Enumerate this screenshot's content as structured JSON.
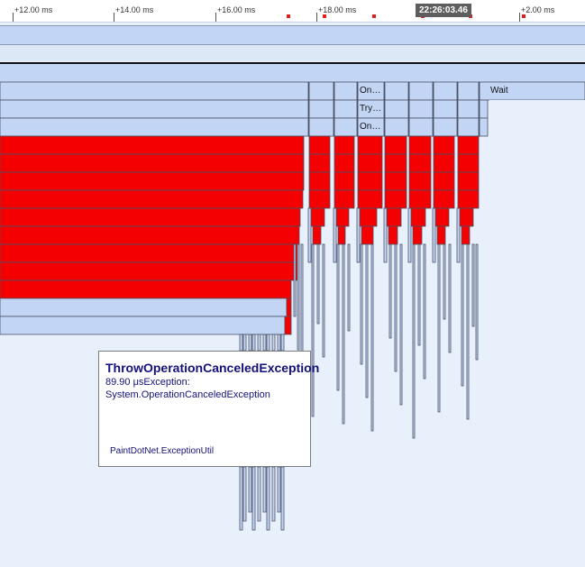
{
  "ruler": {
    "ticks": [
      "+12.00 ms",
      "+14.00 ms",
      "+16.00 ms",
      "+18.00 ms",
      "+2.00 ms"
    ],
    "timestamp": "22:26:03.46"
  },
  "rows": {
    "label_on_1": "On…",
    "label_try": "Try…",
    "label_on_2": "On…",
    "label_wait": "Wait"
  },
  "tooltip": {
    "title": "ThrowOperationCanceledException",
    "line1": "89.90 μsException:",
    "line2": "System.OperationCanceledException",
    "footer": "PaintDotNet.ExceptionUtil"
  },
  "colors": {
    "hot": "#f40000",
    "frame": "#c2d5f4",
    "background": "#e8f0fb",
    "tooltip_text": "#13117b"
  }
}
